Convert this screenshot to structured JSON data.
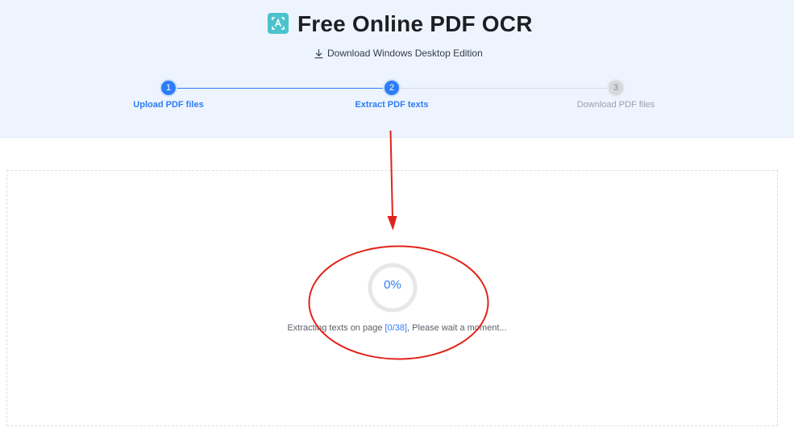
{
  "header": {
    "title": "Free Online PDF OCR",
    "download_link": "Download Windows Desktop Edition",
    "logo_icon": "ocr-scan-icon"
  },
  "steps": [
    {
      "number": "1",
      "label": "Upload PDF files",
      "state": "done"
    },
    {
      "number": "2",
      "label": "Extract PDF texts",
      "state": "current"
    },
    {
      "number": "3",
      "label": "Download PDF files",
      "state": "pending"
    }
  ],
  "progress": {
    "percent_text": "0%",
    "percent_value": 0,
    "status_prefix": "Extracting texts on page ",
    "page_count": "[0/38]",
    "status_suffix": ", Please wait a moment..."
  },
  "colors": {
    "accent": "#2e7cf6",
    "header_bg": "#eef4fd",
    "logo": "#4cc3cc",
    "annotation": "#e0231b"
  }
}
